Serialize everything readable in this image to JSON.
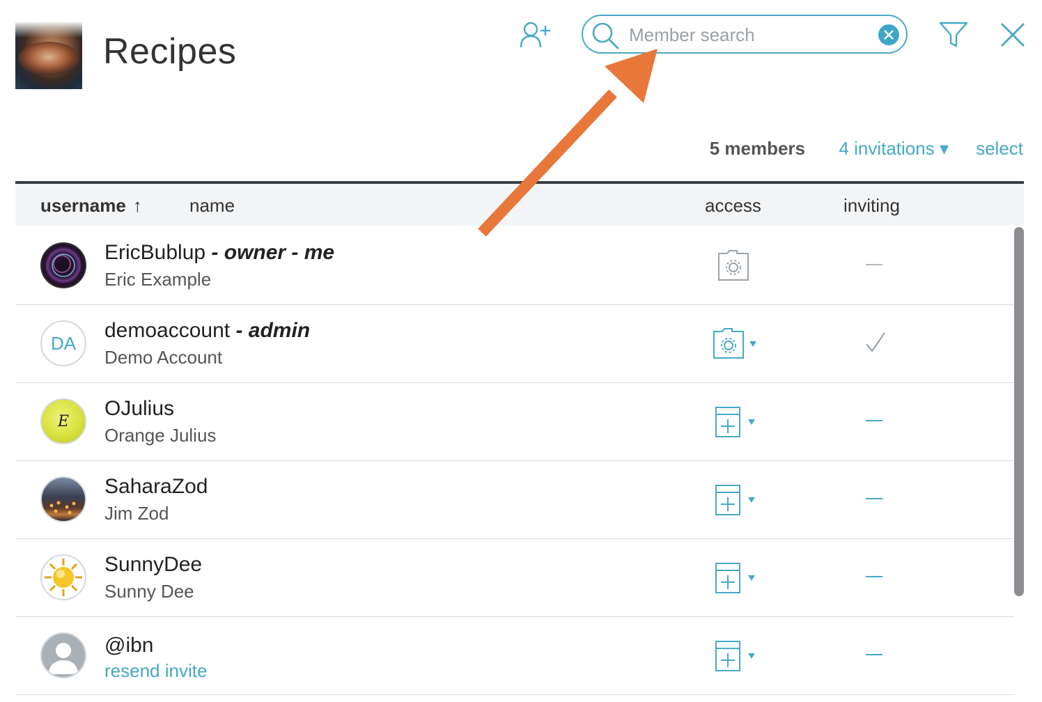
{
  "header": {
    "title": "Recipes",
    "thumbnail_icon": "recipe-photo",
    "add_member_icon": "add-user-icon",
    "search_placeholder": "Member search",
    "search_value": "",
    "filter_icon": "filter-icon",
    "close_icon": "close-icon"
  },
  "summary": {
    "members_label": "5 members",
    "invitations_label": "4 invitations ▾",
    "select_label": "select"
  },
  "table": {
    "columns": {
      "username": "username",
      "sort_indicator": "↑",
      "name": "name",
      "access": "access",
      "inviting": "inviting"
    },
    "rows": [
      {
        "username": "EricBublup",
        "role": " - owner - me",
        "name": "Eric Example",
        "avatar": "bubble-photo",
        "access_icon": "folder-settings-icon",
        "access_dropdown": false,
        "inviting": "dash"
      },
      {
        "username": "demoaccount",
        "role": " - admin",
        "name": "Demo Account",
        "avatar_initials": "DA",
        "access_icon": "folder-settings-icon",
        "access_dropdown": true,
        "inviting": "check"
      },
      {
        "username": "OJulius",
        "role": "",
        "name": "Orange Julius",
        "avatar": "tennis-ball-photo",
        "avatar_letter": "E",
        "access_icon": "add-item-icon",
        "access_dropdown": true,
        "inviting": "dash"
      },
      {
        "username": "SaharaZod",
        "role": "",
        "name": "Jim Zod",
        "avatar": "lanterns-photo",
        "access_icon": "add-item-icon",
        "access_dropdown": true,
        "inviting": "dash"
      },
      {
        "username": "SunnyDee",
        "role": "",
        "name": "Sunny Dee",
        "avatar": "sun-photo",
        "access_icon": "add-item-icon",
        "access_dropdown": true,
        "inviting": "dash"
      },
      {
        "username": "@ibn",
        "role": "",
        "name": "resend invite",
        "avatar": "default-user-avatar",
        "access_icon": "add-item-icon",
        "access_dropdown": true,
        "inviting": "dash"
      }
    ]
  },
  "colors": {
    "accent": "#46a9c6",
    "annotation_arrow": "#e8773a",
    "header_bg": "#f3f4f6"
  }
}
